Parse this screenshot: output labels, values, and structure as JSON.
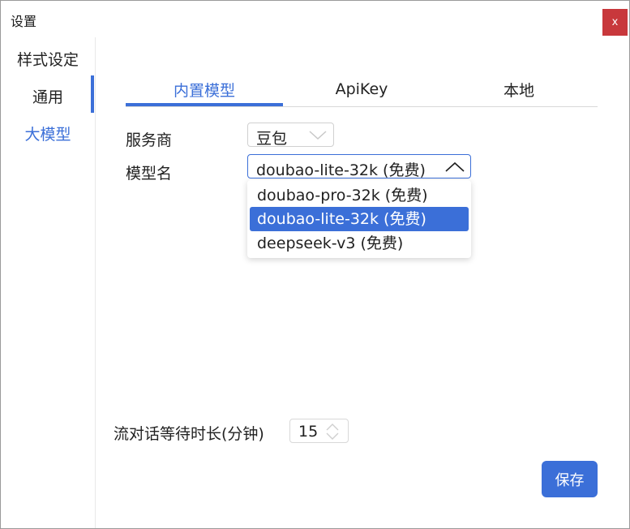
{
  "window": {
    "title": "设置",
    "close_label": "x"
  },
  "sidebar": {
    "items": [
      {
        "label": "样式设定"
      },
      {
        "label": "通用"
      },
      {
        "label": "大模型",
        "active": true
      }
    ]
  },
  "tabs": [
    {
      "label": "内置模型",
      "active": true
    },
    {
      "label": "ApiKey"
    },
    {
      "label": "本地"
    }
  ],
  "form": {
    "provider_label": "服务商",
    "provider_value": "豆包",
    "model_label": "模型名",
    "model_value": "doubao-lite-32k (免费)",
    "model_options": [
      {
        "label": "doubao-pro-32k (免费)"
      },
      {
        "label": "doubao-lite-32k (免费)",
        "selected": true
      },
      {
        "label": "deepseek-v3 (免费)"
      }
    ],
    "wait_label": "流对话等待时长(分钟)",
    "wait_value": "15"
  },
  "actions": {
    "save_label": "保存"
  },
  "colors": {
    "accent": "#3b6fd8",
    "close_bg": "#c8383c"
  }
}
